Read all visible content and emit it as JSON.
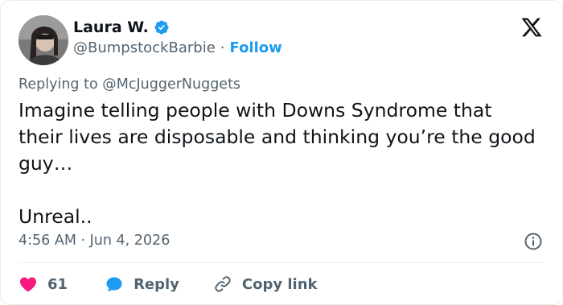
{
  "author": {
    "display_name": "Laura W.",
    "handle": "@BumpstockBarbie",
    "separator": "·",
    "follow_label": "Follow"
  },
  "reply_context": {
    "prefix": "Replying to",
    "mention": "@McJuggerNuggets"
  },
  "tweet": {
    "paragraph_1": "Imagine telling people with Downs Syndrome that their lives are disposable and thinking you’re the good guy…",
    "paragraph_2": "Unreal.."
  },
  "timestamp": "4:56 AM · Jun 4, 2026",
  "actions": {
    "like_count": "61",
    "reply_label": "Reply",
    "copy_link_label": "Copy link"
  },
  "colors": {
    "accent": "#1d9bf0",
    "like": "#f91880",
    "text": "#0f1419",
    "muted": "#536471"
  },
  "icons": [
    "verified-badge-icon",
    "x-logo-icon",
    "info-icon",
    "heart-icon",
    "reply-bubble-icon",
    "link-icon"
  ]
}
